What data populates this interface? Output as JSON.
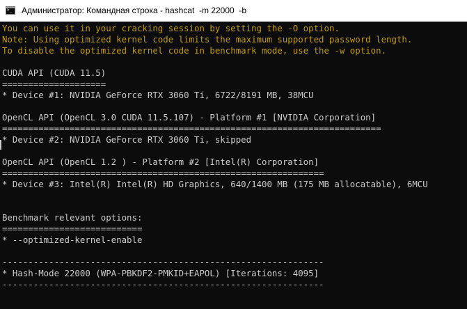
{
  "window": {
    "title": "Администратор: Командная строка - hashcat  -m 22000  -b",
    "icon": "cmd-icon"
  },
  "console": {
    "lines": [
      {
        "text": "You can use it in your cracking session by setting the -O option.",
        "color": "#c19c00"
      },
      {
        "text": "Note: Using optimized kernel code limits the maximum supported password length.",
        "color": "#c19c00"
      },
      {
        "text": "To disable the optimized kernel code in benchmark mode, use the -w option.",
        "color": "#c19c00"
      },
      {
        "text": "",
        "color": "#cccccc"
      },
      {
        "text": "CUDA API (CUDA 11.5)",
        "color": "#cccccc"
      },
      {
        "text": "====================",
        "color": "#cccccc"
      },
      {
        "text": "* Device #1: NVIDIA GeForce RTX 3060 Ti, 6722/8191 MB, 38MCU",
        "color": "#cccccc"
      },
      {
        "text": "",
        "color": "#cccccc"
      },
      {
        "text": "OpenCL API (OpenCL 3.0 CUDA 11.5.107) - Platform #1 [NVIDIA Corporation]",
        "color": "#cccccc"
      },
      {
        "text": "=========================================================================",
        "color": "#cccccc"
      },
      {
        "text": "* Device #2: NVIDIA GeForce RTX 3060 Ti, skipped",
        "color": "#cccccc"
      },
      {
        "text": "",
        "color": "#cccccc"
      },
      {
        "text": "OpenCL API (OpenCL 1.2 ) - Platform #2 [Intel(R) Corporation]",
        "color": "#cccccc"
      },
      {
        "text": "==============================================================",
        "color": "#cccccc"
      },
      {
        "text": "* Device #3: Intel(R) Intel(R) HD Graphics, 640/1400 MB (175 MB allocatable), 6MCU",
        "color": "#cccccc"
      },
      {
        "text": "",
        "color": "#cccccc"
      },
      {
        "text": "",
        "color": "#cccccc"
      },
      {
        "text": "Benchmark relevant options:",
        "color": "#cccccc"
      },
      {
        "text": "===========================",
        "color": "#cccccc"
      },
      {
        "text": "* --optimized-kernel-enable",
        "color": "#cccccc"
      },
      {
        "text": "",
        "color": "#cccccc"
      },
      {
        "text": "--------------------------------------------------------------",
        "color": "#cccccc"
      },
      {
        "text": "* Hash-Mode 22000 (WPA-PBKDF2-PMKID+EAPOL) [Iterations: 4095]",
        "color": "#cccccc"
      },
      {
        "text": "--------------------------------------------------------------",
        "color": "#cccccc"
      }
    ]
  }
}
